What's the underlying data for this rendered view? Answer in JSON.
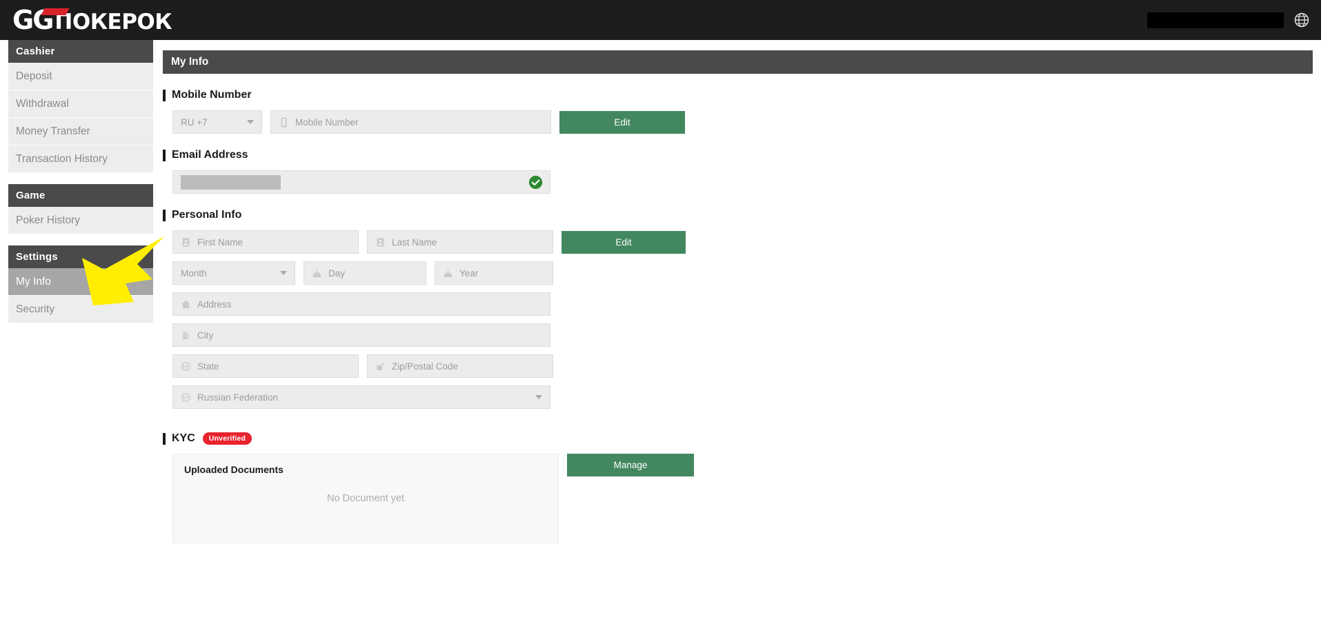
{
  "topbar": {
    "logo_gg": "GG",
    "logo_text": "ПОКЕРОК",
    "redacted_label": "",
    "globe_icon": "globe-icon"
  },
  "sidebar": {
    "groups": [
      {
        "header": "Cashier",
        "items": [
          {
            "label": "Deposit",
            "active": false
          },
          {
            "label": "Withdrawal",
            "active": false
          },
          {
            "label": "Money Transfer",
            "active": false
          },
          {
            "label": "Transaction History",
            "active": false
          }
        ]
      },
      {
        "header": "Game",
        "items": [
          {
            "label": "Poker History",
            "active": false
          }
        ]
      },
      {
        "header": "Settings",
        "items": [
          {
            "label": "My Info",
            "active": true
          },
          {
            "label": "Security",
            "active": false
          }
        ]
      }
    ]
  },
  "main": {
    "header_title": "My Info",
    "mobile": {
      "title": "Mobile Number",
      "country_code": "RU +7",
      "number_placeholder": "Mobile Number",
      "edit_label": "Edit"
    },
    "email": {
      "title": "Email Address",
      "value_masked": "",
      "verified_icon": "check-circle-icon"
    },
    "personal": {
      "title": "Personal Info",
      "first_name_placeholder": "First Name",
      "last_name_placeholder": "Last Name",
      "month_placeholder": "Month",
      "day_placeholder": "Day",
      "year_placeholder": "Year",
      "address_placeholder": "Address",
      "city_placeholder": "City",
      "state_placeholder": "State",
      "zip_placeholder": "Zip/Postal Code",
      "country_value": "Russian Federation",
      "edit_label": "Edit"
    },
    "kyc": {
      "title": "KYC",
      "status_badge": "Unverified",
      "uploaded_title": "Uploaded Documents",
      "empty_text": "No Document yet",
      "manage_label": "Manage"
    }
  },
  "colors": {
    "brand_red": "#d8232a",
    "accent_green": "#43875f",
    "badge_red": "#e8242e",
    "header_gray": "#4a4a4a",
    "active_item": "#a6a6a6",
    "cursor_yellow": "#ffee00"
  }
}
